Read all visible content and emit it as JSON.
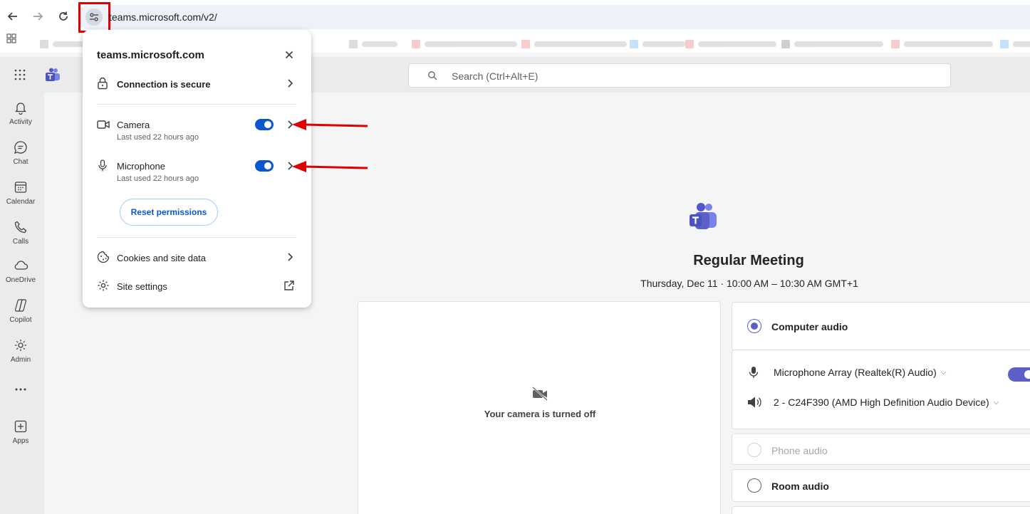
{
  "browser": {
    "url": "teams.microsoft.com/v2/"
  },
  "search": {
    "placeholder": "Search (Ctrl+Alt+E)"
  },
  "rail": {
    "items": [
      {
        "label": "Activity",
        "icon": "bell-icon"
      },
      {
        "label": "Chat",
        "icon": "chat-icon"
      },
      {
        "label": "Calendar",
        "icon": "calendar-icon"
      },
      {
        "label": "Calls",
        "icon": "phone-icon"
      },
      {
        "label": "OneDrive",
        "icon": "cloud-icon"
      },
      {
        "label": "Copilot",
        "icon": "copilot-icon"
      },
      {
        "label": "Admin",
        "icon": "admin-icon"
      },
      {
        "label": "...",
        "icon": "more-icon"
      },
      {
        "label": "Apps",
        "icon": "plus-square-icon"
      }
    ]
  },
  "meeting": {
    "title": "Regular Meeting",
    "day": "Thursday, Dec 11",
    "start": "10:00 AM",
    "end": "10:30 AM GMT+1",
    "camera_off_text": "Your camera is turned off"
  },
  "audio": {
    "computer_audio": "Computer audio",
    "microphone_device": "Microphone Array (Realtek(R) Audio)",
    "speaker_device": "2 - C24F390 (AMD High Definition Audio Device)",
    "phone_audio": "Phone audio",
    "room_audio": "Room audio"
  },
  "popup": {
    "title": "teams.microsoft.com",
    "connection": "Connection is secure",
    "camera_label": "Camera",
    "camera_sub": "Last used 22 hours ago",
    "camera_enabled": true,
    "microphone_label": "Microphone",
    "microphone_sub": "Last used 22 hours ago",
    "microphone_enabled": true,
    "reset": "Reset permissions",
    "cookies": "Cookies and site data",
    "site_settings": "Site settings"
  },
  "colors": {
    "accent": "#0b57d0",
    "teams_purple": "#5b5fc7",
    "annotation_red": "#e00000"
  }
}
